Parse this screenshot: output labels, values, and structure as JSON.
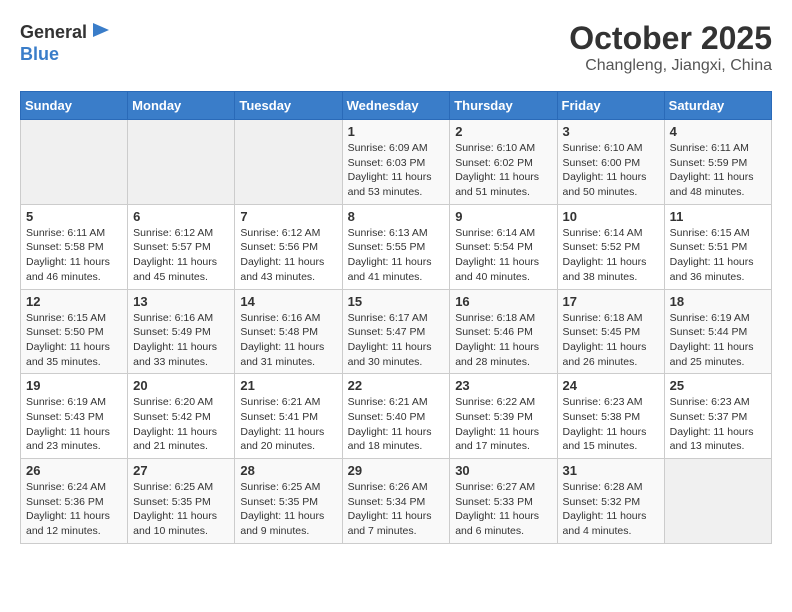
{
  "header": {
    "logo_line1": "General",
    "logo_line2": "Blue",
    "month": "October 2025",
    "location": "Changleng, Jiangxi, China"
  },
  "weekdays": [
    "Sunday",
    "Monday",
    "Tuesday",
    "Wednesday",
    "Thursday",
    "Friday",
    "Saturday"
  ],
  "weeks": [
    [
      {
        "day": "",
        "sunrise": "",
        "sunset": "",
        "daylight": "",
        "empty": true
      },
      {
        "day": "",
        "sunrise": "",
        "sunset": "",
        "daylight": "",
        "empty": true
      },
      {
        "day": "",
        "sunrise": "",
        "sunset": "",
        "daylight": "",
        "empty": true
      },
      {
        "day": "1",
        "sunrise": "Sunrise: 6:09 AM",
        "sunset": "Sunset: 6:03 PM",
        "daylight": "Daylight: 11 hours and 53 minutes."
      },
      {
        "day": "2",
        "sunrise": "Sunrise: 6:10 AM",
        "sunset": "Sunset: 6:02 PM",
        "daylight": "Daylight: 11 hours and 51 minutes."
      },
      {
        "day": "3",
        "sunrise": "Sunrise: 6:10 AM",
        "sunset": "Sunset: 6:00 PM",
        "daylight": "Daylight: 11 hours and 50 minutes."
      },
      {
        "day": "4",
        "sunrise": "Sunrise: 6:11 AM",
        "sunset": "Sunset: 5:59 PM",
        "daylight": "Daylight: 11 hours and 48 minutes."
      }
    ],
    [
      {
        "day": "5",
        "sunrise": "Sunrise: 6:11 AM",
        "sunset": "Sunset: 5:58 PM",
        "daylight": "Daylight: 11 hours and 46 minutes."
      },
      {
        "day": "6",
        "sunrise": "Sunrise: 6:12 AM",
        "sunset": "Sunset: 5:57 PM",
        "daylight": "Daylight: 11 hours and 45 minutes."
      },
      {
        "day": "7",
        "sunrise": "Sunrise: 6:12 AM",
        "sunset": "Sunset: 5:56 PM",
        "daylight": "Daylight: 11 hours and 43 minutes."
      },
      {
        "day": "8",
        "sunrise": "Sunrise: 6:13 AM",
        "sunset": "Sunset: 5:55 PM",
        "daylight": "Daylight: 11 hours and 41 minutes."
      },
      {
        "day": "9",
        "sunrise": "Sunrise: 6:14 AM",
        "sunset": "Sunset: 5:54 PM",
        "daylight": "Daylight: 11 hours and 40 minutes."
      },
      {
        "day": "10",
        "sunrise": "Sunrise: 6:14 AM",
        "sunset": "Sunset: 5:52 PM",
        "daylight": "Daylight: 11 hours and 38 minutes."
      },
      {
        "day": "11",
        "sunrise": "Sunrise: 6:15 AM",
        "sunset": "Sunset: 5:51 PM",
        "daylight": "Daylight: 11 hours and 36 minutes."
      }
    ],
    [
      {
        "day": "12",
        "sunrise": "Sunrise: 6:15 AM",
        "sunset": "Sunset: 5:50 PM",
        "daylight": "Daylight: 11 hours and 35 minutes."
      },
      {
        "day": "13",
        "sunrise": "Sunrise: 6:16 AM",
        "sunset": "Sunset: 5:49 PM",
        "daylight": "Daylight: 11 hours and 33 minutes."
      },
      {
        "day": "14",
        "sunrise": "Sunrise: 6:16 AM",
        "sunset": "Sunset: 5:48 PM",
        "daylight": "Daylight: 11 hours and 31 minutes."
      },
      {
        "day": "15",
        "sunrise": "Sunrise: 6:17 AM",
        "sunset": "Sunset: 5:47 PM",
        "daylight": "Daylight: 11 hours and 30 minutes."
      },
      {
        "day": "16",
        "sunrise": "Sunrise: 6:18 AM",
        "sunset": "Sunset: 5:46 PM",
        "daylight": "Daylight: 11 hours and 28 minutes."
      },
      {
        "day": "17",
        "sunrise": "Sunrise: 6:18 AM",
        "sunset": "Sunset: 5:45 PM",
        "daylight": "Daylight: 11 hours and 26 minutes."
      },
      {
        "day": "18",
        "sunrise": "Sunrise: 6:19 AM",
        "sunset": "Sunset: 5:44 PM",
        "daylight": "Daylight: 11 hours and 25 minutes."
      }
    ],
    [
      {
        "day": "19",
        "sunrise": "Sunrise: 6:19 AM",
        "sunset": "Sunset: 5:43 PM",
        "daylight": "Daylight: 11 hours and 23 minutes."
      },
      {
        "day": "20",
        "sunrise": "Sunrise: 6:20 AM",
        "sunset": "Sunset: 5:42 PM",
        "daylight": "Daylight: 11 hours and 21 minutes."
      },
      {
        "day": "21",
        "sunrise": "Sunrise: 6:21 AM",
        "sunset": "Sunset: 5:41 PM",
        "daylight": "Daylight: 11 hours and 20 minutes."
      },
      {
        "day": "22",
        "sunrise": "Sunrise: 6:21 AM",
        "sunset": "Sunset: 5:40 PM",
        "daylight": "Daylight: 11 hours and 18 minutes."
      },
      {
        "day": "23",
        "sunrise": "Sunrise: 6:22 AM",
        "sunset": "Sunset: 5:39 PM",
        "daylight": "Daylight: 11 hours and 17 minutes."
      },
      {
        "day": "24",
        "sunrise": "Sunrise: 6:23 AM",
        "sunset": "Sunset: 5:38 PM",
        "daylight": "Daylight: 11 hours and 15 minutes."
      },
      {
        "day": "25",
        "sunrise": "Sunrise: 6:23 AM",
        "sunset": "Sunset: 5:37 PM",
        "daylight": "Daylight: 11 hours and 13 minutes."
      }
    ],
    [
      {
        "day": "26",
        "sunrise": "Sunrise: 6:24 AM",
        "sunset": "Sunset: 5:36 PM",
        "daylight": "Daylight: 11 hours and 12 minutes."
      },
      {
        "day": "27",
        "sunrise": "Sunrise: 6:25 AM",
        "sunset": "Sunset: 5:35 PM",
        "daylight": "Daylight: 11 hours and 10 minutes."
      },
      {
        "day": "28",
        "sunrise": "Sunrise: 6:25 AM",
        "sunset": "Sunset: 5:35 PM",
        "daylight": "Daylight: 11 hours and 9 minutes."
      },
      {
        "day": "29",
        "sunrise": "Sunrise: 6:26 AM",
        "sunset": "Sunset: 5:34 PM",
        "daylight": "Daylight: 11 hours and 7 minutes."
      },
      {
        "day": "30",
        "sunrise": "Sunrise: 6:27 AM",
        "sunset": "Sunset: 5:33 PM",
        "daylight": "Daylight: 11 hours and 6 minutes."
      },
      {
        "day": "31",
        "sunrise": "Sunrise: 6:28 AM",
        "sunset": "Sunset: 5:32 PM",
        "daylight": "Daylight: 11 hours and 4 minutes."
      },
      {
        "day": "",
        "sunrise": "",
        "sunset": "",
        "daylight": "",
        "empty": true
      }
    ]
  ]
}
